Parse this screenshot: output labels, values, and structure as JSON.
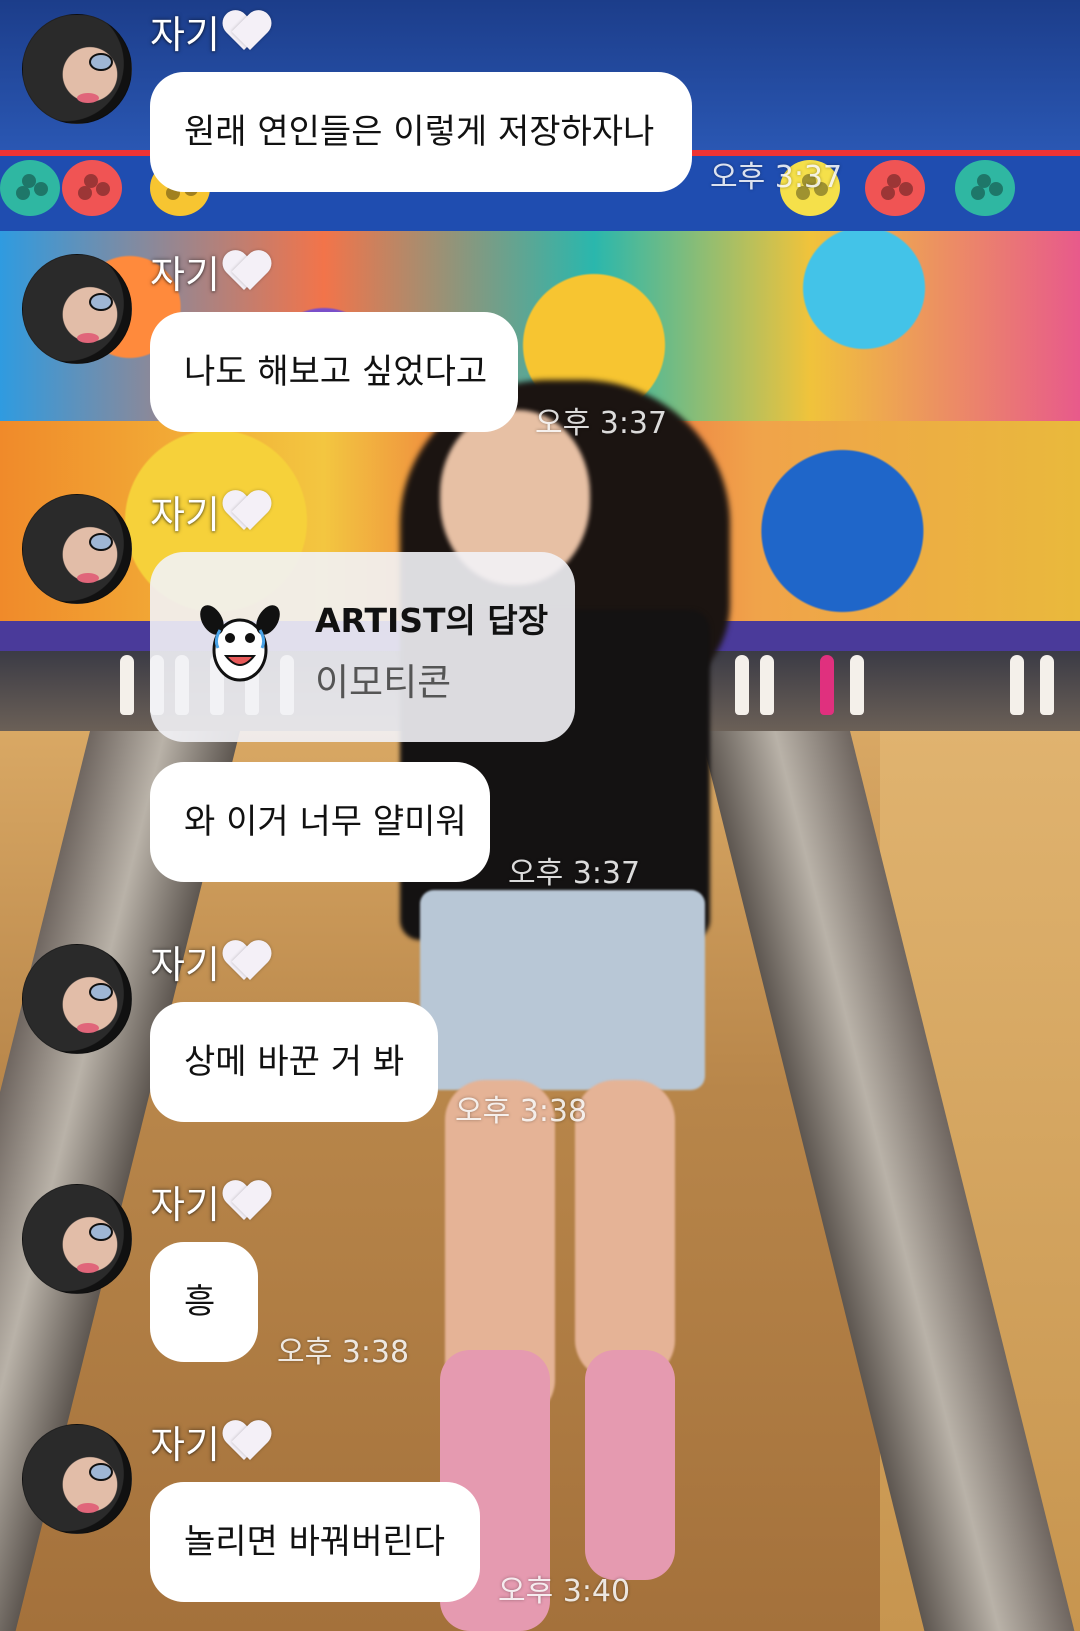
{
  "messages": [
    {
      "sender": "자기",
      "text": "원래 연인들은 이렇게 저장하자나",
      "time": "오후 3:37"
    },
    {
      "sender": "자기",
      "text": "나도 해보고 싶었다고",
      "time": "오후 3:37"
    },
    {
      "sender": "자기",
      "reply_header": "ARTIST의 답장",
      "reply_body": "이모티콘",
      "text": "와 이거 너무 얄미워",
      "time": "오후 3:37"
    },
    {
      "sender": "자기",
      "text": "상메 바꾼 거 봐",
      "time": "오후 3:38"
    },
    {
      "sender": "자기",
      "text": "흥",
      "time": "오후 3:38"
    },
    {
      "sender": "자기",
      "text": "놀리면 바꿔버린다",
      "time": "오후 3:40"
    }
  ],
  "icons": {
    "heart": "white-heart-icon",
    "sticker": "cartoon-dog-sticker-icon",
    "avatar": "profile-photo-avatar"
  },
  "colors": {
    "bubble": "#ffffff",
    "reply_bubble": "#f2f2f6",
    "text": "#111111",
    "reply_muted": "#555555"
  }
}
